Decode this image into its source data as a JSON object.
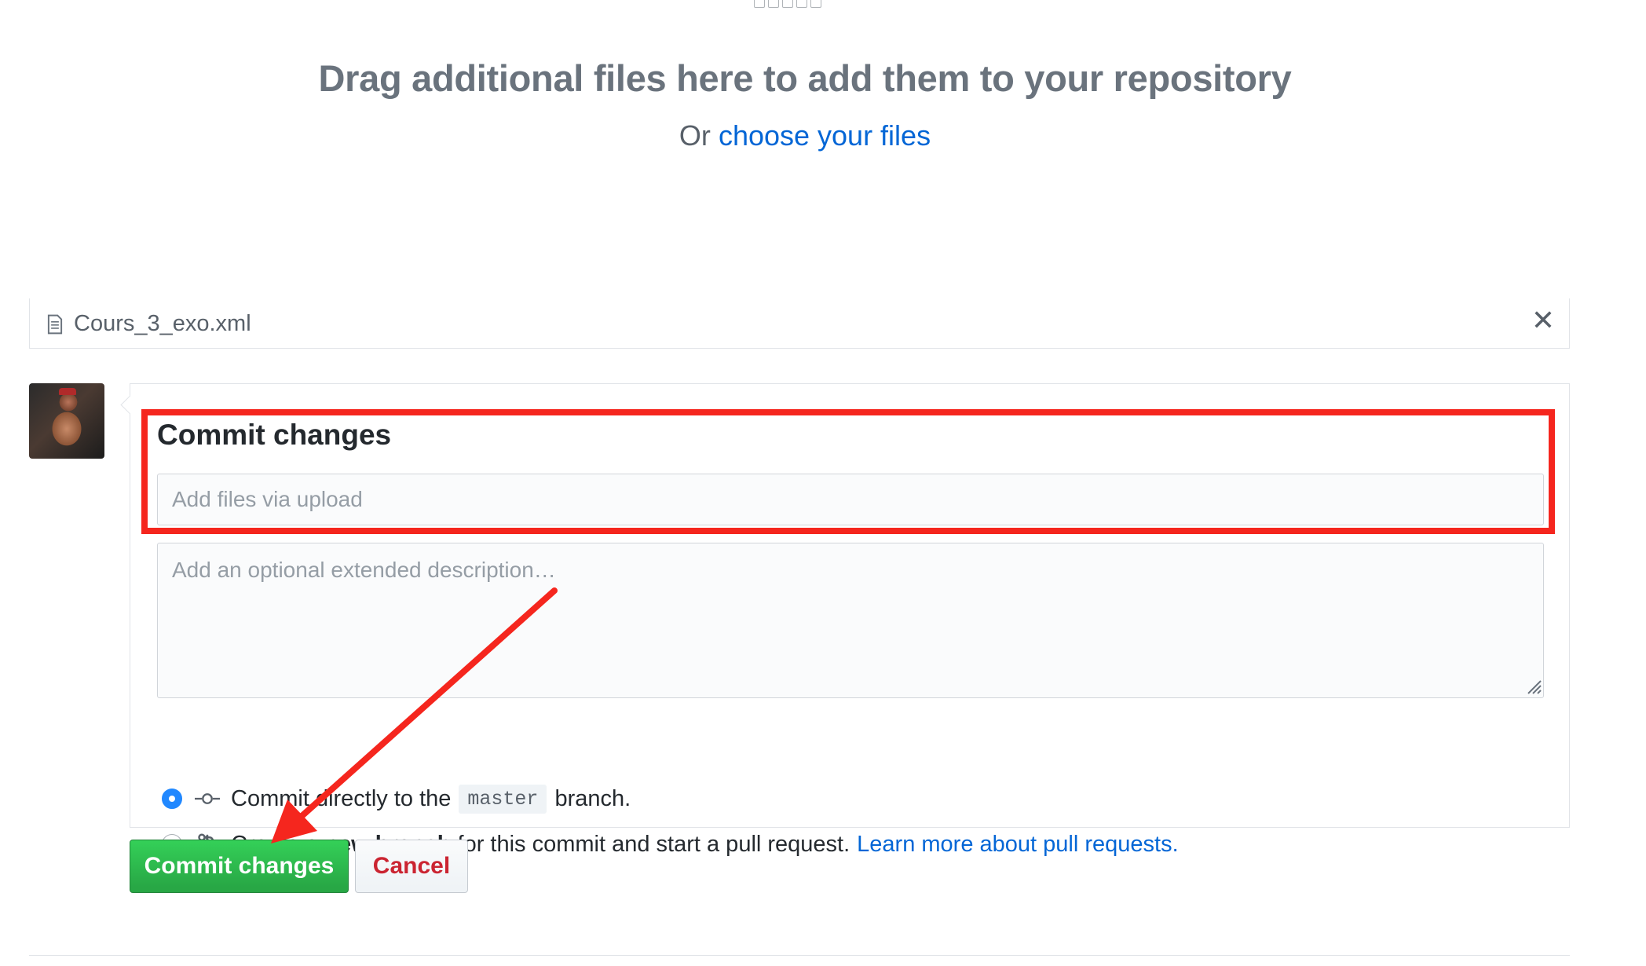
{
  "upload": {
    "title": "Drag additional files here to add them to your repository",
    "subtitle_prefix": "Or",
    "choose_link": "choose your files"
  },
  "file": {
    "name": "Cours_3_exo.xml",
    "close_glyph": "✕"
  },
  "commit": {
    "heading": "Commit changes",
    "summary_placeholder": "Add files via upload",
    "description_placeholder": "Add an optional extended description…",
    "options": {
      "direct_prefix": "Commit directly to the",
      "branch_name": "master",
      "direct_suffix": "branch.",
      "new_prefix": "Create a",
      "new_bold": "new branch",
      "new_suffix": "for this commit and start a pull request.",
      "learn_more": "Learn more about pull requests."
    },
    "selected_option": "direct"
  },
  "buttons": {
    "commit": "Commit changes",
    "cancel": "Cancel"
  },
  "annotation": {
    "highlight_color": "#f5261e",
    "arrow_color": "#f5261e"
  },
  "icons": [
    "file-icon",
    "close-icon",
    "commit-icon",
    "pull-request-icon",
    "avatar"
  ]
}
